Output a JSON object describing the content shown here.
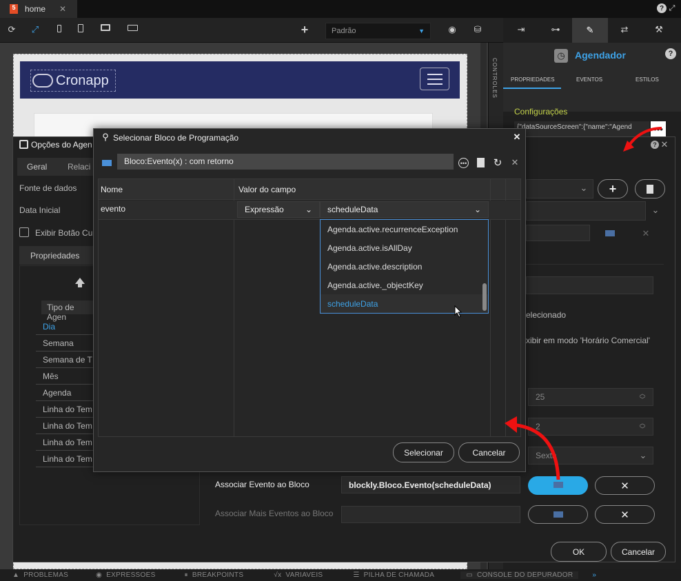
{
  "tab": {
    "label": "home"
  },
  "toolbar": {
    "screen_select": "Padrão"
  },
  "right": {
    "title": "Agendador",
    "tabs": [
      "PROPRIEDADES",
      "EVENTOS",
      "ESTILOS"
    ],
    "section": "Configurações",
    "config_value": "{\"dataSourceScreen\":{\"name\":\"Agend"
  },
  "controls_label": "CONTROLES",
  "preview": {
    "logo": "Cronapp"
  },
  "opts": {
    "title": "Opções do Agen",
    "tabs": [
      "Geral",
      "Relaci"
    ],
    "fields": [
      "Fonte de dados",
      "Data Inicial"
    ],
    "checkbox": "Exibir Botão Cu",
    "prop_tab": "Propriedades",
    "type_header": "Tipo de Agen",
    "types": [
      "Dia",
      "Semana",
      "Semana de T",
      "Mês",
      "Agenda",
      "Linha do Tem",
      "Linha do Tem",
      "Linha do Tem",
      "Linha do Tem"
    ],
    "selecionado": "elecionado",
    "horario": "xibir em modo 'Horário Comercial'",
    "num1": "25",
    "num2": "2",
    "weekday": "Sexta",
    "assoc_label": "Associar Evento ao Bloco",
    "assoc_value": "blockly.Bloco.Evento(scheduleData)",
    "assoc_more_label": "Associar Mais Eventos ao Bloco",
    "ok": "OK",
    "cancel": "Cancelar"
  },
  "dialog": {
    "title": "Selecionar Bloco de Programação",
    "block": "Bloco:Evento(x) : com retorno",
    "col_name": "Nome",
    "col_value": "Valor do campo",
    "row_name": "evento",
    "type_select": "Expressão",
    "value_select": "scheduleData",
    "options": [
      "Agenda.active.recurrenceException",
      "Agenda.active.isAllDay",
      "Agenda.active.description",
      "Agenda.active._objectKey",
      "scheduleData"
    ],
    "select_btn": "Selecionar",
    "cancel_btn": "Cancelar"
  },
  "bottom": [
    "PROBLEMAS",
    "EXPRESSOES",
    "BREAKPOINTS",
    "VARIAVEIS",
    "PILHA DE CHAMADA",
    "CONSOLE DO DEPURADOR"
  ]
}
